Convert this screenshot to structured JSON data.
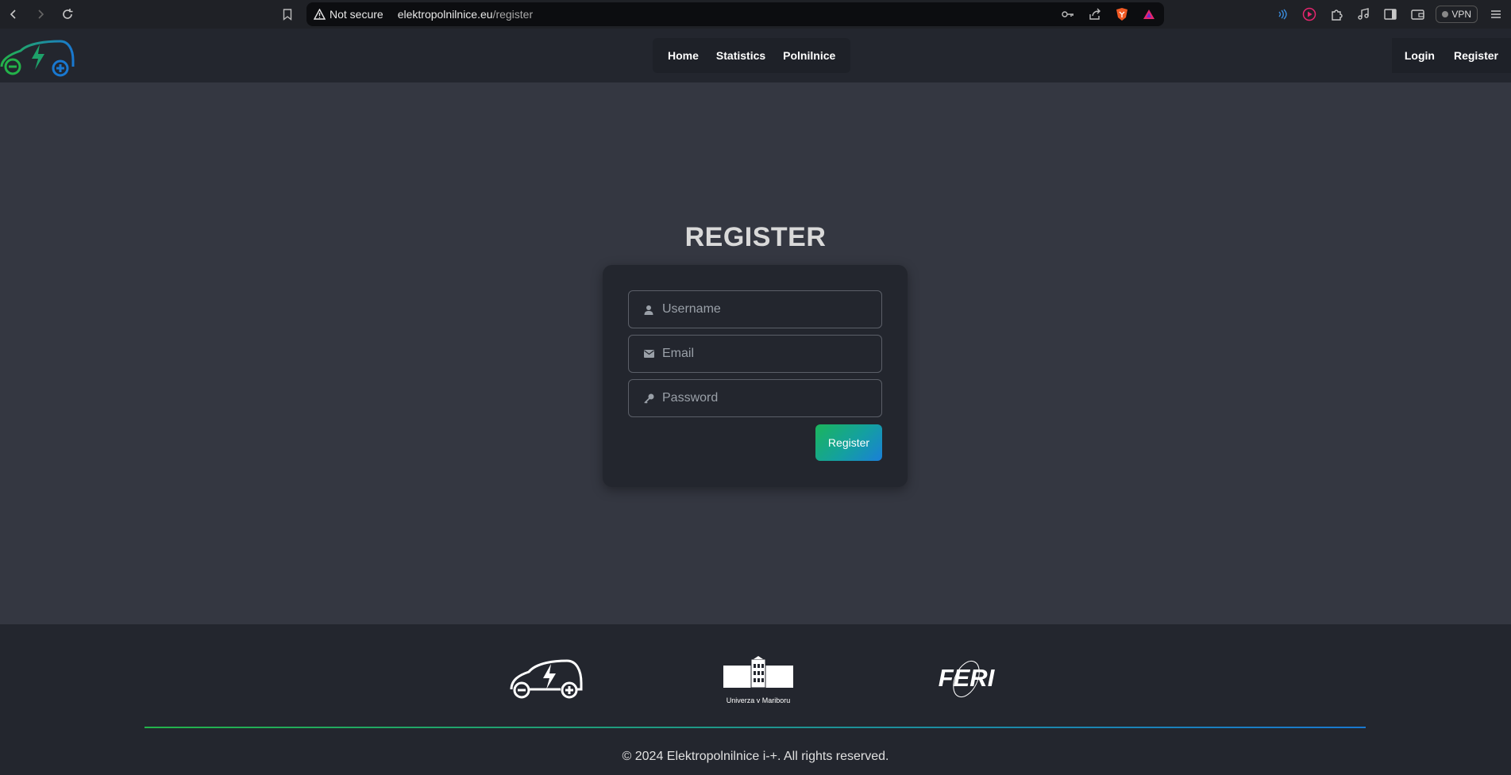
{
  "browser": {
    "security_label": "Not secure",
    "url_host": "elektropolnilnice.eu",
    "url_path": "/register",
    "vpn_label": "VPN"
  },
  "nav": {
    "links": [
      "Home",
      "Statistics",
      "Polnilnice"
    ],
    "auth": [
      "Login",
      "Register"
    ]
  },
  "register": {
    "title": "REGISTER",
    "username_placeholder": "Username",
    "email_placeholder": "Email",
    "password_placeholder": "Password",
    "submit_label": "Register"
  },
  "footer": {
    "um_logo_text": "Univerza v Mariboru",
    "feri_logo_text": "FERI",
    "copyright": "© 2024 Elektropolnilnice i-+. All rights reserved."
  },
  "colors": {
    "brand_green": "#23b34a",
    "brand_blue": "#1978d0",
    "page_bg": "#343741",
    "header_bg": "#23262e"
  }
}
